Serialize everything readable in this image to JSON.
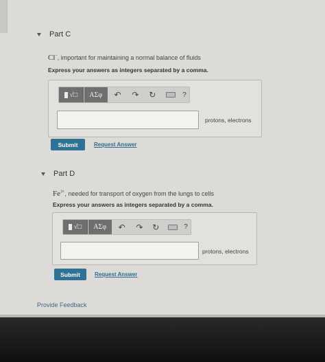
{
  "parts": [
    {
      "title": "Part C",
      "ion": "Cl",
      "ion_charge": "−",
      "question_text": ", important for maintaining a normal balance of fluids",
      "instruction": "Express your answers as integers separated by a comma.",
      "units": "protons, electrons",
      "submit_label": "Submit",
      "request_label": "Request Answer",
      "input_value": ""
    },
    {
      "title": "Part D",
      "ion": "Fe",
      "ion_charge": "3+",
      "question_text": ", needed for transport of oxygen from the lungs to cells",
      "instruction": "Express your answers as integers separated by a comma.",
      "units": "protons, electrons",
      "submit_label": "Submit",
      "request_label": "Request Answer",
      "input_value": ""
    }
  ],
  "toolbar": {
    "templates_radical": "√□",
    "greek_label": "ΑΣφ",
    "help_label": "?",
    "icons": [
      "templates-icon",
      "greek-symbols-icon",
      "undo-icon",
      "redo-icon",
      "reset-icon",
      "keyboard-icon",
      "help-icon"
    ]
  },
  "footer": {
    "feedback_label": "Provide Feedback"
  },
  "colors": {
    "submit_bg": "#2e7396",
    "link": "#2e6d8f",
    "page_bg": "#dcdbd7"
  }
}
